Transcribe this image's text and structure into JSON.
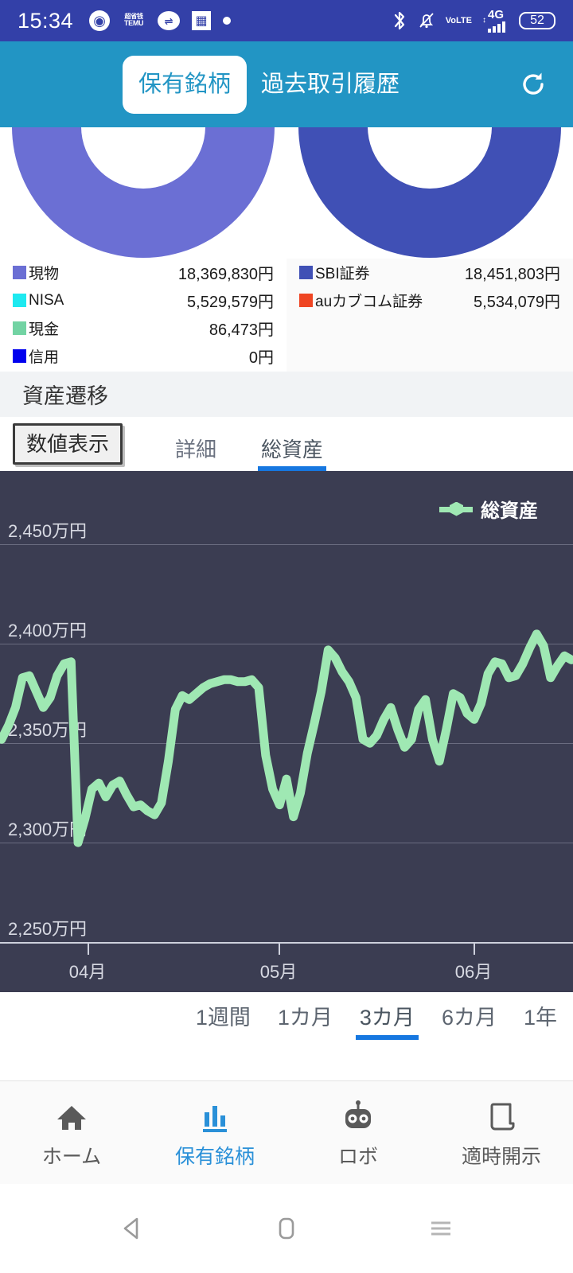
{
  "statusbar": {
    "time": "15:34",
    "left_icons": [
      "chrome-icon",
      "temu-icon",
      "oval-icon",
      "gallery-icon",
      "dot-icon"
    ],
    "temu_top": "超省钱",
    "temu_bottom": "TEMU",
    "bluetooth": "bluetooth-icon",
    "silent": "bell-muted-icon",
    "volte_top": "Vo",
    "volte_bottom": "LTE",
    "network": "4G",
    "battery": "52"
  },
  "appbar": {
    "tabs": [
      {
        "label": "保有銘柄",
        "active": true
      },
      {
        "label": "過去取引履歴",
        "active": false
      }
    ],
    "refresh": "refresh-icon",
    "bg_color": "#2295c4"
  },
  "donuts": [
    {
      "name": "asset-type-donut",
      "color": "#6b6fd4"
    },
    {
      "name": "broker-donut",
      "color": "#4050b5"
    }
  ],
  "legend": {
    "left": [
      {
        "label": "現物",
        "value": "18,369,830円",
        "color": "#6b6fd4"
      },
      {
        "label": "NISA",
        "value": "5,529,579円",
        "color": "#1ee9f0"
      },
      {
        "label": "現金",
        "value": "86,473円",
        "color": "#72d3a3"
      },
      {
        "label": "信用",
        "value": "0円",
        "color": "#0000ee"
      }
    ],
    "right": [
      {
        "label": "SBI証券",
        "value": "18,451,803円",
        "color": "#4050b5"
      },
      {
        "label": "auカブコム証券",
        "value": "5,534,079円",
        "color": "#ef4523"
      }
    ]
  },
  "section": {
    "title": "資産遷移"
  },
  "controls": {
    "numeric_button": "数値表示",
    "sub_tabs": [
      {
        "label": "詳細",
        "active": false
      },
      {
        "label": "総資産",
        "active": true
      }
    ],
    "accent": "#1677e0"
  },
  "periods": [
    {
      "label": "1週間",
      "active": false
    },
    {
      "label": "1カ月",
      "active": false
    },
    {
      "label": "3カ月",
      "active": true
    },
    {
      "label": "6カ月",
      "active": false
    },
    {
      "label": "1年",
      "active": false
    }
  ],
  "bottom_nav": [
    {
      "label": "ホーム",
      "icon": "home-icon",
      "active": false
    },
    {
      "label": "保有銘柄",
      "icon": "bar-chart-icon",
      "active": true
    },
    {
      "label": "ロボ",
      "icon": "robot-icon",
      "active": false
    },
    {
      "label": "適時開示",
      "icon": "document-icon",
      "active": false
    }
  ],
  "android_nav": [
    "back-icon",
    "home-icon",
    "recents-icon"
  ],
  "chart_data": {
    "type": "line",
    "title": "資産遷移",
    "legend": [
      {
        "name": "総資産",
        "color": "#9fe8b3"
      }
    ],
    "legend_position": "top-right",
    "grid": true,
    "background": "#3b3d52",
    "xlabel": "",
    "ylabel": "",
    "ylim": [
      2250,
      2475
    ],
    "y_unit": "万円",
    "y_ticks": [
      2450,
      2400,
      2350,
      2300,
      2250
    ],
    "y_tick_labels": [
      "2,450万円",
      "2,400万円",
      "2,350万円",
      "2,300万円",
      "2,250万円"
    ],
    "x_ticks": [
      "04月",
      "05月",
      "06月"
    ],
    "x_tick_positions": [
      110,
      350,
      595
    ],
    "series": [
      {
        "name": "総資産",
        "color": "#9fe8b3",
        "values": [
          2352,
          2359,
          2368,
          2383,
          2384,
          2376,
          2368,
          2373,
          2384,
          2390,
          2391,
          2300,
          2312,
          2327,
          2330,
          2323,
          2329,
          2331,
          2324,
          2318,
          2319,
          2316,
          2314,
          2320,
          2341,
          2367,
          2374,
          2372,
          2375,
          2378,
          2380,
          2381,
          2382,
          2382,
          2381,
          2381,
          2382,
          2378,
          2344,
          2327,
          2319,
          2332,
          2313,
          2325,
          2345,
          2360,
          2376,
          2397,
          2393,
          2386,
          2381,
          2373,
          2352,
          2350,
          2354,
          2362,
          2368,
          2357,
          2348,
          2352,
          2367,
          2372,
          2352,
          2341,
          2357,
          2375,
          2373,
          2365,
          2362,
          2370,
          2385,
          2391,
          2390,
          2383,
          2384,
          2390,
          2398,
          2405,
          2399,
          2383,
          2389,
          2394,
          2392
        ]
      }
    ]
  }
}
